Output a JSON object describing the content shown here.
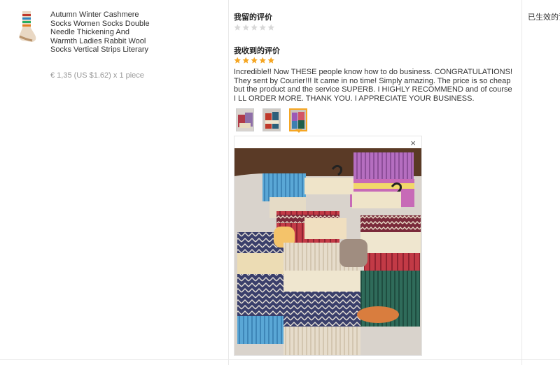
{
  "product": {
    "title": "Autumn Winter Cashmere Socks Women Socks Double Needle Thickening And Warmth Ladies Rabbit Wool Socks Vertical Strips Literary",
    "price": "€ 1,35 (US $1.62) x 1 piece"
  },
  "my_review": {
    "heading": "我留的评价",
    "rating": 0,
    "max_rating": 5
  },
  "received_review": {
    "heading": "我收到的评价",
    "rating": 5,
    "max_rating": 5,
    "text": "Incredible!! Now THESE people know how to do business. CONGRATULATIONS! They sent by Courier!!! It came in no time! Simply amazing. The price is so cheap but the product and the service SUPERB. I HIGHLY RECOMMEND and of course I LL ORDER MORE. THANK YOU. I APPRECIATE YOUR BUSINESS.",
    "photo_count": 3,
    "selected_photo": 3
  },
  "viewer": {
    "close_glyph": "×"
  },
  "right_column": {
    "text": "已生效的评"
  },
  "colors": {
    "star_filled": "#f5a623",
    "star_empty": "#d8d8d8",
    "active_thumb_border": "#f5a623"
  }
}
